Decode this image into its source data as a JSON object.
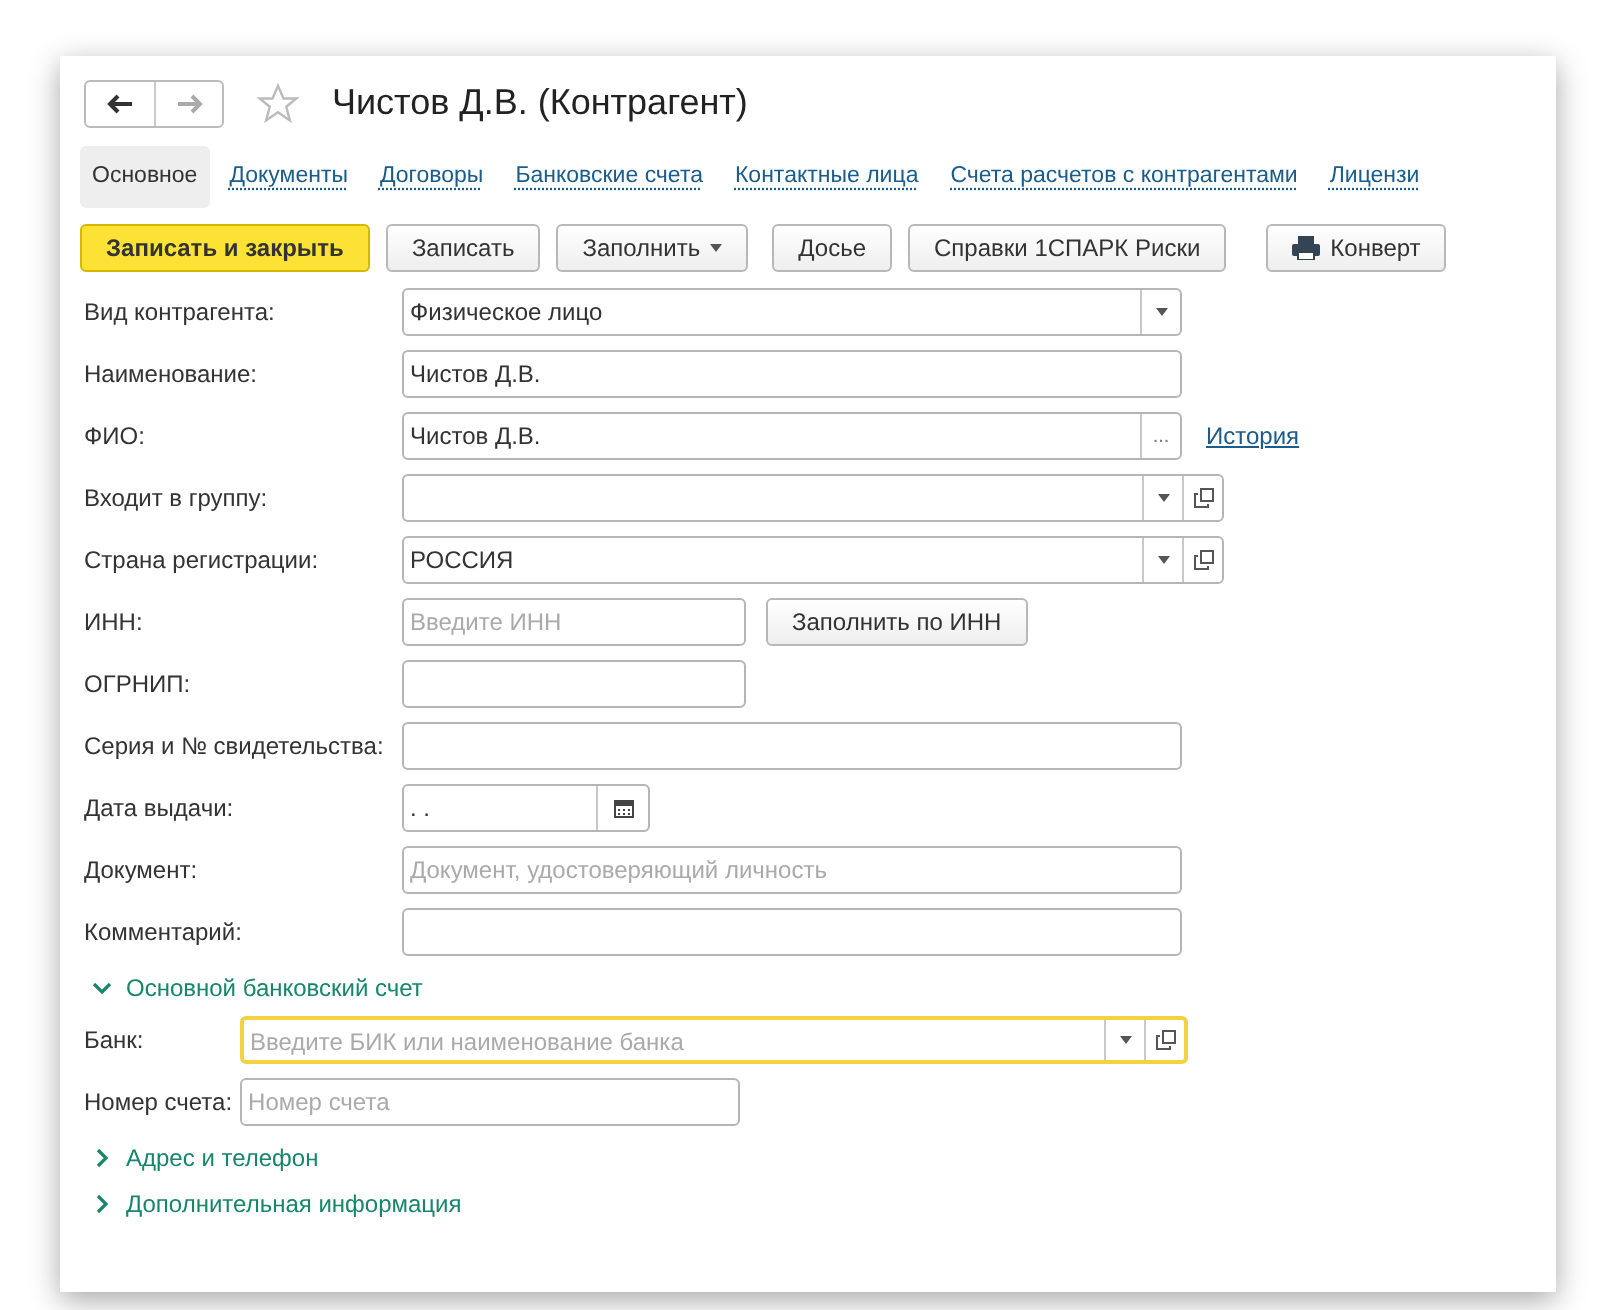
{
  "window": {
    "title": "Чистов Д.В. (Контрагент)",
    "favorite": false
  },
  "tabs": [
    {
      "label": "Основное",
      "selected": true
    },
    {
      "label": "Документы",
      "selected": false
    },
    {
      "label": "Договоры",
      "selected": false
    },
    {
      "label": "Банковские счета",
      "selected": false
    },
    {
      "label": "Контактные лица",
      "selected": false
    },
    {
      "label": "Счета расчетов с контрагентами",
      "selected": false
    },
    {
      "label": "Лицензи",
      "selected": false
    }
  ],
  "toolbar": [
    {
      "label": "Записать и закрыть",
      "kind": "primary"
    },
    {
      "label": "Записать",
      "kind": "plain"
    },
    {
      "label": "Заполнить",
      "kind": "menu"
    },
    {
      "label": "Досье",
      "kind": "plain"
    },
    {
      "label": "Справки 1СПАРК Риски",
      "kind": "plain"
    },
    {
      "label": "Конверт",
      "kind": "print"
    }
  ],
  "fields": [
    {
      "label": "Вид контрагента:",
      "kind": "select",
      "value": "Физическое лицо"
    },
    {
      "label": "Наименование:",
      "kind": "text",
      "value": "Чистов Д.В."
    },
    {
      "label": "ФИО:",
      "kind": "choice",
      "value": "Чистов Д.В.",
      "choice_button": "...",
      "link": "История"
    },
    {
      "label": "Входит в группу:",
      "kind": "select-open"
    },
    {
      "label": "Страна регистрации:",
      "kind": "select-open",
      "value": "РОССИЯ"
    },
    {
      "label": "ИНН:",
      "kind": "text",
      "placeholder": "Введите ИНН",
      "button": "Заполнить по ИНН"
    },
    {
      "label": "ОГРНИП:",
      "kind": "text"
    },
    {
      "label": "Серия и № свидетельства:",
      "kind": "text"
    },
    {
      "label": "Дата выдачи:",
      "kind": "date",
      "value": " .  ."
    },
    {
      "label": "Документ:",
      "kind": "text",
      "placeholder": "Документ, удостоверяющий личность"
    },
    {
      "label": "Комментарий:",
      "kind": "text"
    }
  ],
  "sections": [
    {
      "title": "Основной банковский счет",
      "expanded": true,
      "fields": [
        {
          "label": "Банк:",
          "kind": "select-open",
          "placeholder": "Введите БИК или наименование банка",
          "focused": true
        },
        {
          "label": "Номер счета:",
          "kind": "text",
          "placeholder": "Номер счета",
          "focused": false
        }
      ]
    },
    {
      "title": "Адрес и телефон",
      "expanded": false
    },
    {
      "title": "Дополнительная информация",
      "expanded": false
    }
  ]
}
